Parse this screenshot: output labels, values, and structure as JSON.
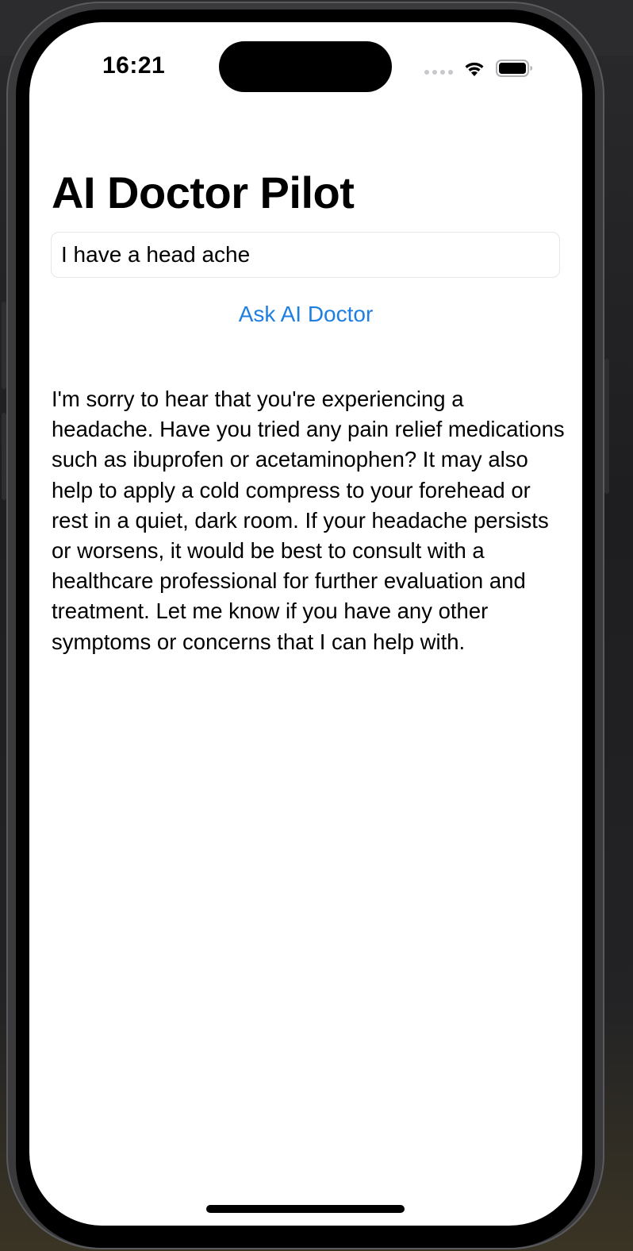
{
  "status_bar": {
    "time": "16:21",
    "icons": [
      "cellular-signal-icon",
      "wifi-icon",
      "battery-icon"
    ]
  },
  "page": {
    "title": "AI Doctor Pilot"
  },
  "query": {
    "value": "I have a head ache"
  },
  "actions": {
    "ask_label": "Ask AI Doctor"
  },
  "response": {
    "text": "I'm sorry to hear that you're experiencing a headache. Have you tried any pain relief medications such as ibuprofen or acetaminophen? It may also help to apply a cold compress to your forehead or rest in a quiet, dark room. If your headache persists or worsens, it would be best to consult with a healthcare professional for further evaluation and treatment. Let me know if you have any other symptoms or concerns that I can help with."
  },
  "colors": {
    "accent": "#1f7fe0",
    "background": "#ffffff",
    "text": "#000000"
  }
}
